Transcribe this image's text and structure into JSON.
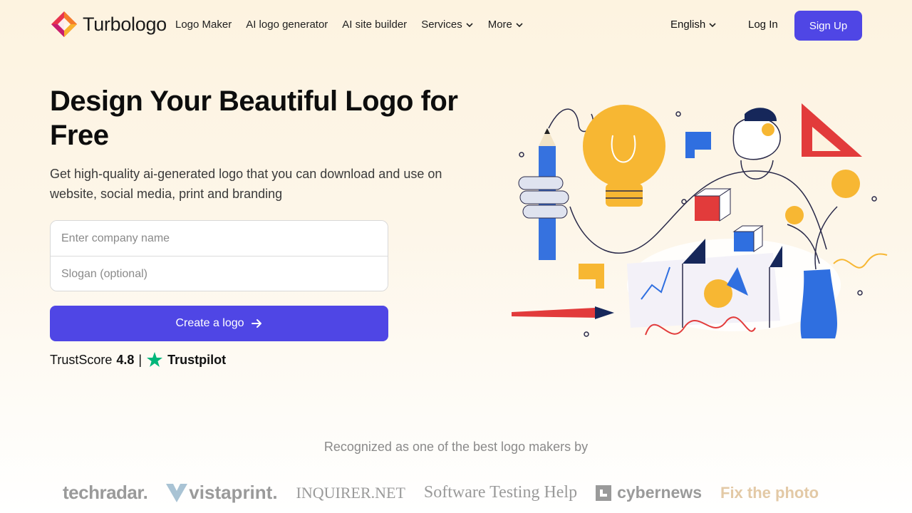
{
  "header": {
    "brand": "Turbologo",
    "nav": [
      {
        "label": "Logo Maker",
        "dropdown": false
      },
      {
        "label": "AI logo generator",
        "dropdown": false
      },
      {
        "label": "AI site builder",
        "dropdown": false
      },
      {
        "label": "Services",
        "dropdown": true
      },
      {
        "label": "More",
        "dropdown": true
      }
    ],
    "language": "English",
    "login": "Log In",
    "signup": "Sign Up"
  },
  "hero": {
    "title": "Design Your Beautiful Logo for Free",
    "subtitle": "Get high-quality ai-generated logo that you can download and use on website, social media, print and branding",
    "company_placeholder": "Enter company name",
    "slogan_placeholder": "Slogan (optional)",
    "cta": "Create a logo",
    "trust_label": "TrustScore",
    "trust_score": "4.8",
    "trust_sep": "|",
    "trustpilot": "Trustpilot"
  },
  "recognized": {
    "heading": "Recognized as one of the best logo makers by",
    "press": [
      "techradar.",
      "vistaprint.",
      "INQUIRER.NET",
      "Software Testing Help",
      "cybernews",
      "Fix the photo"
    ]
  },
  "colors": {
    "accent": "#4f46e5",
    "trustpilot_green": "#00b67a",
    "bulb": "#f7b733",
    "blue": "#2f6fe0",
    "red": "#e23b3b"
  }
}
